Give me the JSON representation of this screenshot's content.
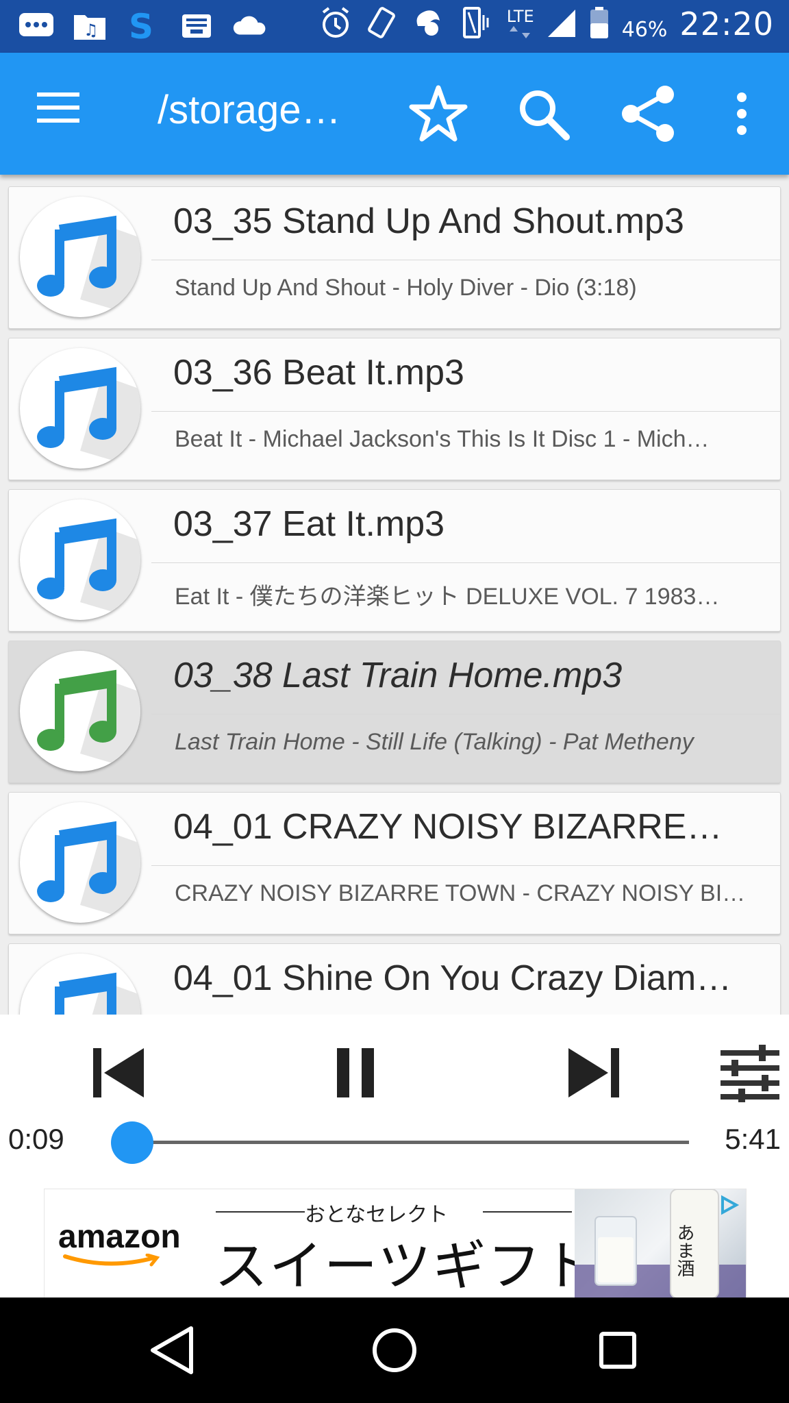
{
  "status_bar": {
    "time": "22:20",
    "battery_percent": "46%",
    "network_label": "LTE",
    "icons": [
      "messenger-icon",
      "music-app-icon",
      "s-app-icon",
      "inbox-icon",
      "cloud-icon",
      "alarm-icon",
      "rotate-icon",
      "data-saver-icon",
      "vibrate-icon",
      "lte-signal-icon",
      "signal-icon",
      "battery-icon"
    ]
  },
  "app_bar": {
    "title": "/storage…",
    "actions": [
      "menu-icon",
      "star-icon",
      "search-icon",
      "share-icon",
      "more-vert-icon"
    ]
  },
  "tracks": [
    {
      "title": "03_35 Stand Up And Shout.mp3",
      "subtitle": "Stand Up And Shout - Holy Diver - Dio (3:18)",
      "playing": false
    },
    {
      "title": "03_36 Beat It.mp3",
      "subtitle": "Beat It - Michael Jackson's This Is It Disc 1 - Mich…",
      "playing": false
    },
    {
      "title": "03_37 Eat It.mp3",
      "subtitle": "Eat It - 僕たちの洋楽ヒット DELUXE VOL. 7 1983…",
      "playing": false
    },
    {
      "title": "03_38 Last Train Home.mp3",
      "subtitle": "Last Train Home - Still Life (Talking) - Pat Metheny",
      "playing": true
    },
    {
      "title": "04_01 CRAZY NOISY BIZARRE…",
      "subtitle": "CRAZY NOISY BIZARRE TOWN - CRAZY NOISY BI…",
      "playing": false
    },
    {
      "title": "04_01 Shine On You Crazy Diam…",
      "subtitle": "",
      "playing": false
    }
  ],
  "colors": {
    "status_bar": "#1a4fa3",
    "app_bar": "#2196f3",
    "note_blue": "#1e88e5",
    "note_green": "#43a047",
    "seek_thumb": "#2196f3"
  },
  "player": {
    "current_time": "0:09",
    "total_time": "5:41",
    "progress": 0.03,
    "controls": [
      "skip-previous-icon",
      "pause-icon",
      "skip-next-icon",
      "equalizer-icon"
    ]
  },
  "ad": {
    "logo_text": "amazon",
    "subheading": "おとなセレクト",
    "headline": "スイーツギフト",
    "bottle_label": "あま酒"
  },
  "nav_bar": {
    "buttons": [
      "back-icon",
      "home-icon",
      "recents-icon"
    ]
  }
}
